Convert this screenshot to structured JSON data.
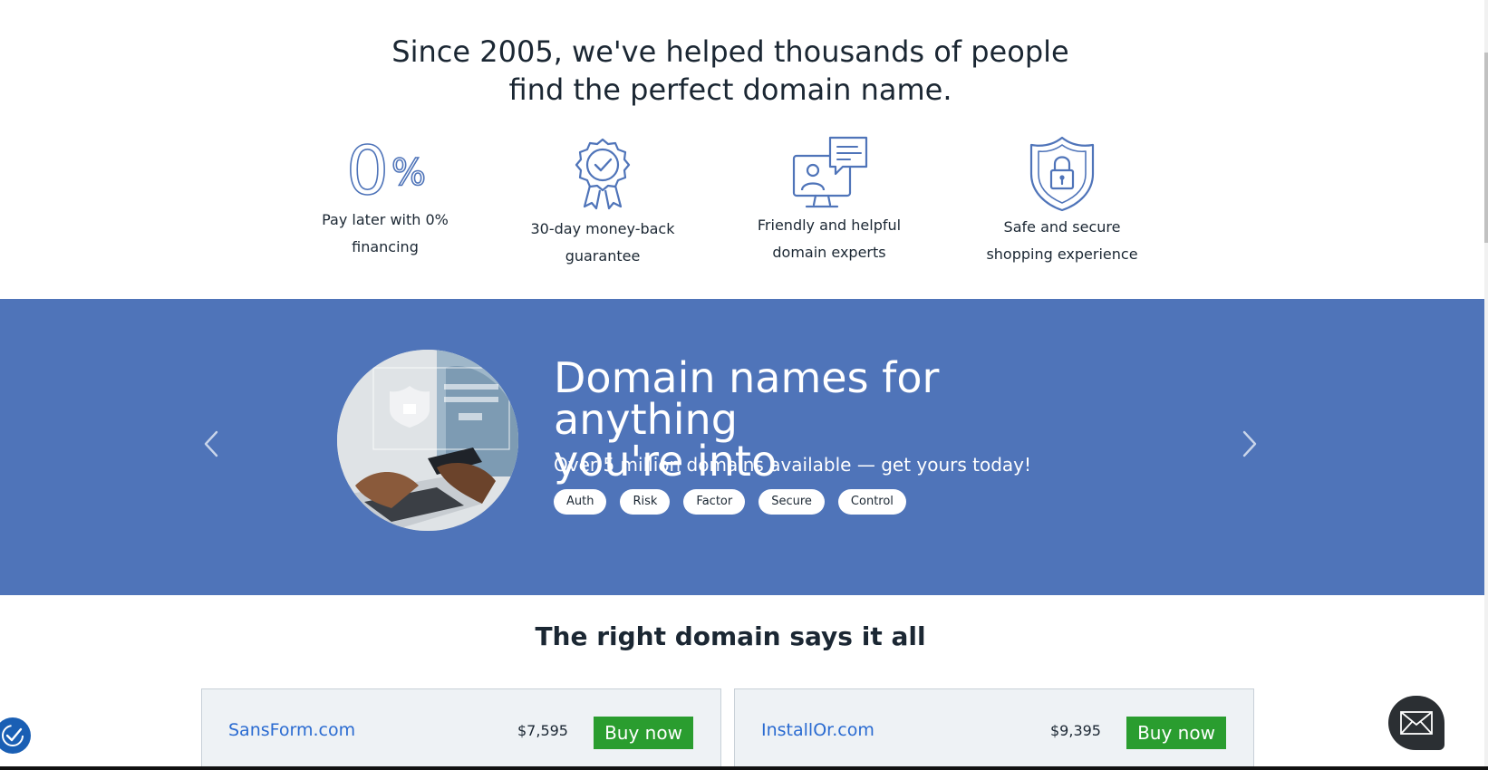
{
  "trust": {
    "heading_line1": "Since 2005, we've helped thousands of people",
    "heading_line2": "find the perfect domain name.",
    "features": [
      {
        "icon": "zero-percent-icon",
        "line1": "Pay later with 0%",
        "line2": "financing",
        "icon_text": "0",
        "icon_suffix": "%"
      },
      {
        "icon": "award-ribbon-icon",
        "line1": "30-day money-back",
        "line2": "guarantee"
      },
      {
        "icon": "chat-support-icon",
        "line1": "Friendly and helpful",
        "line2": "domain experts"
      },
      {
        "icon": "shield-lock-icon",
        "line1": "Safe and secure",
        "line2": "shopping experience"
      }
    ],
    "icon_color": "#4f74b9"
  },
  "banner": {
    "background": "#4f74b9",
    "title_line1": "Domain names for anything",
    "title_line2": "you're into",
    "subtitle": "Over 5 million domains available — get yours today!",
    "tags": [
      "Auth",
      "Risk",
      "Factor",
      "Secure",
      "Control"
    ],
    "image": "person-holding-phone-security-photo",
    "prev_icon": "chevron-left-icon",
    "next_icon": "chevron-right-icon"
  },
  "listings": {
    "heading": "The right domain says it all",
    "cards": [
      {
        "domain": "SansForm.com",
        "price": "$7,595",
        "cta": "Buy now"
      },
      {
        "domain": "InstallOr.com",
        "price": "$9,395",
        "cta": "Buy now"
      }
    ],
    "cta_color": "#2a9d2f",
    "link_color": "#2a6bd1"
  },
  "widgets": {
    "accessibility_icon": "accessibility-check-icon",
    "chat_icon": "envelope-icon"
  }
}
